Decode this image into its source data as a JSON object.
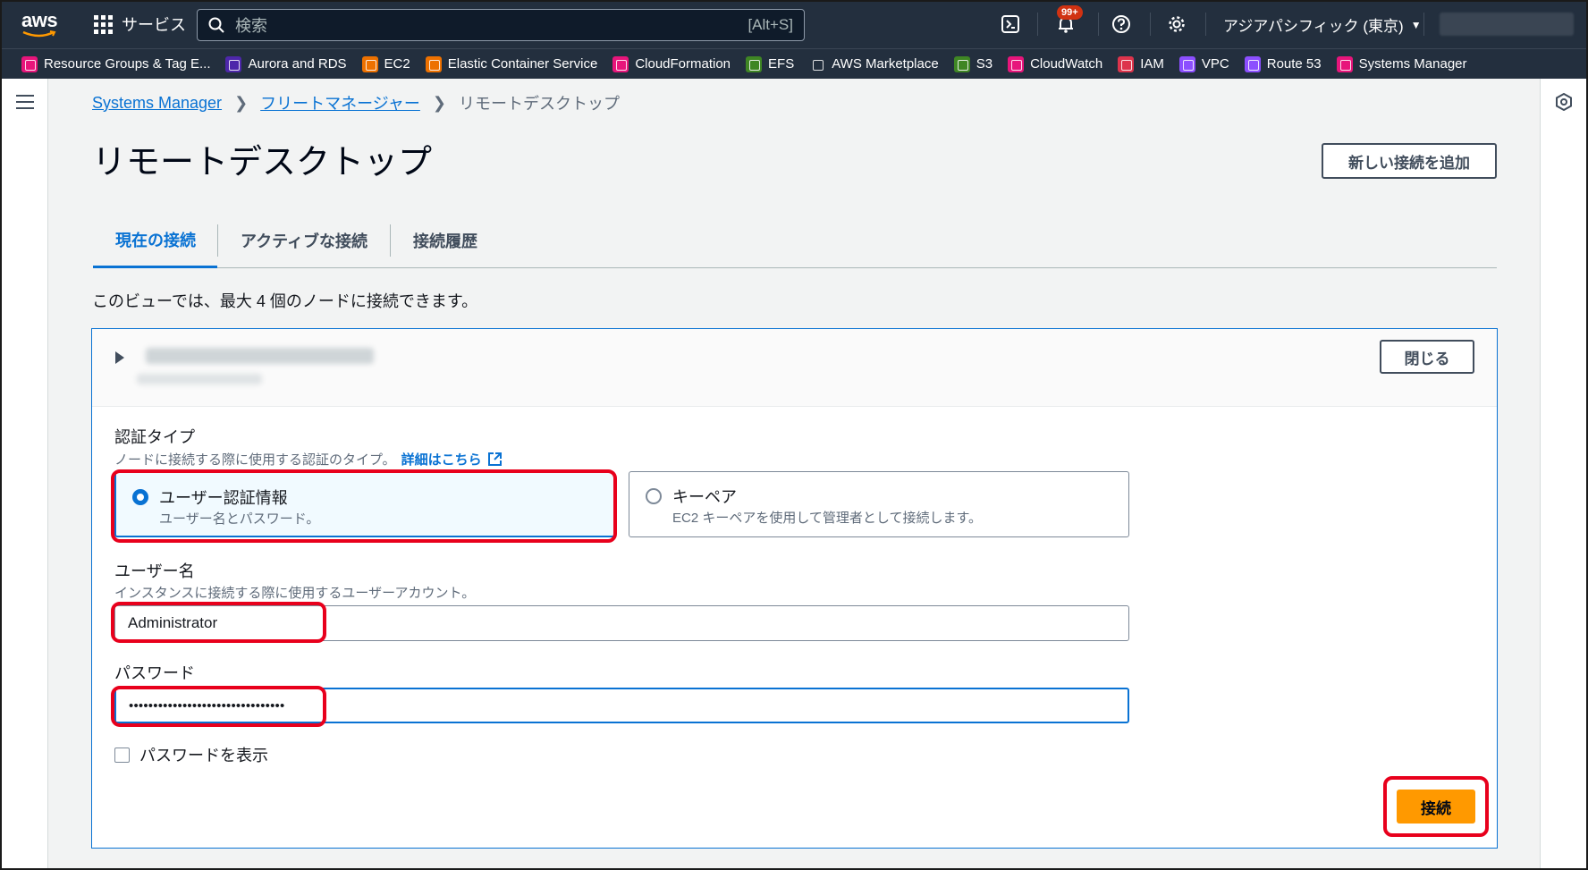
{
  "topnav": {
    "logo": "aws",
    "services_label": "サービス",
    "search_placeholder": "検索",
    "search_shortcut": "[Alt+S]",
    "notification_count": "99+",
    "region": "アジアパシフィック (東京)"
  },
  "favorites": [
    {
      "label": "Resource Groups & Tag E...",
      "color": "#e7157b"
    },
    {
      "label": "Aurora and RDS",
      "color": "#4d27aa"
    },
    {
      "label": "EC2",
      "color": "#ed7100"
    },
    {
      "label": "Elastic Container Service",
      "color": "#ed7100"
    },
    {
      "label": "CloudFormation",
      "color": "#e7157b"
    },
    {
      "label": "EFS",
      "color": "#3f8624"
    },
    {
      "label": "AWS Marketplace",
      "color": "#232f3e"
    },
    {
      "label": "S3",
      "color": "#3f8624"
    },
    {
      "label": "CloudWatch",
      "color": "#e7157b"
    },
    {
      "label": "IAM",
      "color": "#dd344c"
    },
    {
      "label": "VPC",
      "color": "#8c4fff"
    },
    {
      "label": "Route 53",
      "color": "#8c4fff"
    },
    {
      "label": "Systems Manager",
      "color": "#e7157b"
    }
  ],
  "breadcrumb": {
    "item1": "Systems Manager",
    "item2": "フリートマネージャー",
    "current": "リモートデスクトップ"
  },
  "page": {
    "title": "リモートデスクトップ",
    "add_button": "新しい接続を追加",
    "info": "このビューでは、最大 4 個のノードに接続できます。"
  },
  "tabs": [
    {
      "label": "現在の接続",
      "active": true
    },
    {
      "label": "アクティブな接続",
      "active": false
    },
    {
      "label": "接続履歴",
      "active": false
    }
  ],
  "panel": {
    "close_button": "閉じる",
    "auth_label": "認証タイプ",
    "auth_desc": "ノードに接続する際に使用する認証のタイプ。",
    "auth_link": "詳細はこちら",
    "options": [
      {
        "title": "ユーザー認証情報",
        "desc": "ユーザー名とパスワード。",
        "selected": true
      },
      {
        "title": "キーペア",
        "desc": "EC2 キーペアを使用して管理者として接続します。",
        "selected": false
      }
    ],
    "username_label": "ユーザー名",
    "username_desc": "インスタンスに接続する際に使用するユーザーアカウント。",
    "username_value": "Administrator",
    "password_label": "パスワード",
    "password_value": "••••••••••••••••••••••••••••••••",
    "show_password_label": "パスワードを表示",
    "connect_button": "接続"
  },
  "colors": {
    "highlight": "#e8001c",
    "primary": "#0972d3",
    "accent": "#ff9900",
    "nav_bg": "#232f3e"
  }
}
